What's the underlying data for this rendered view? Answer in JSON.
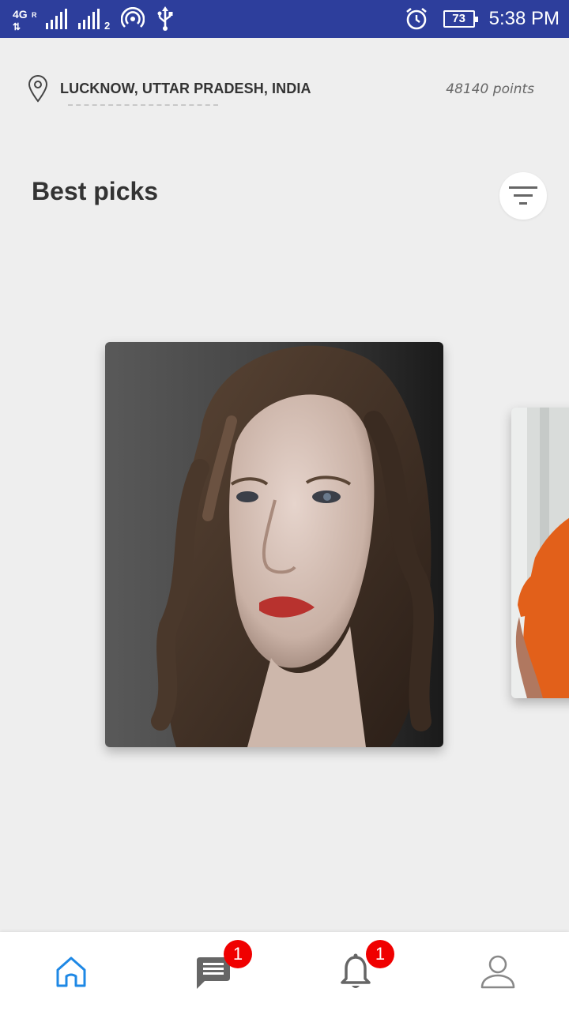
{
  "status_bar": {
    "network_type": "4G",
    "roaming_indicator": "R",
    "sim2_label": "2",
    "battery_level": "73",
    "time": "5:38 PM",
    "icons": [
      "signal-icon",
      "hotspot-icon",
      "usb-icon",
      "alarm-icon",
      "battery-icon"
    ]
  },
  "header": {
    "location": "LUCKNOW, UTTAR PRADESH, INDIA",
    "points": "48140 points"
  },
  "section": {
    "title": "Best picks"
  },
  "cards": [
    {
      "kind": "profile-photo",
      "subject": "woman with wavy hair, red lips, gray background"
    },
    {
      "kind": "profile-photo",
      "subject": "person in orange t-shirt (partially visible)"
    }
  ],
  "bottom_nav": {
    "items": [
      {
        "name": "home",
        "icon": "home-icon",
        "active": true,
        "color": "#1e88e5"
      },
      {
        "name": "messages",
        "icon": "chat-icon",
        "badge": "1"
      },
      {
        "name": "notifications",
        "icon": "bell-icon",
        "badge": "1"
      },
      {
        "name": "profile",
        "icon": "person-icon"
      }
    ]
  },
  "colors": {
    "status_bar": "#2d3e9c",
    "background": "#eeeeee",
    "accent": "#1e88e5",
    "badge": "#f00000"
  }
}
